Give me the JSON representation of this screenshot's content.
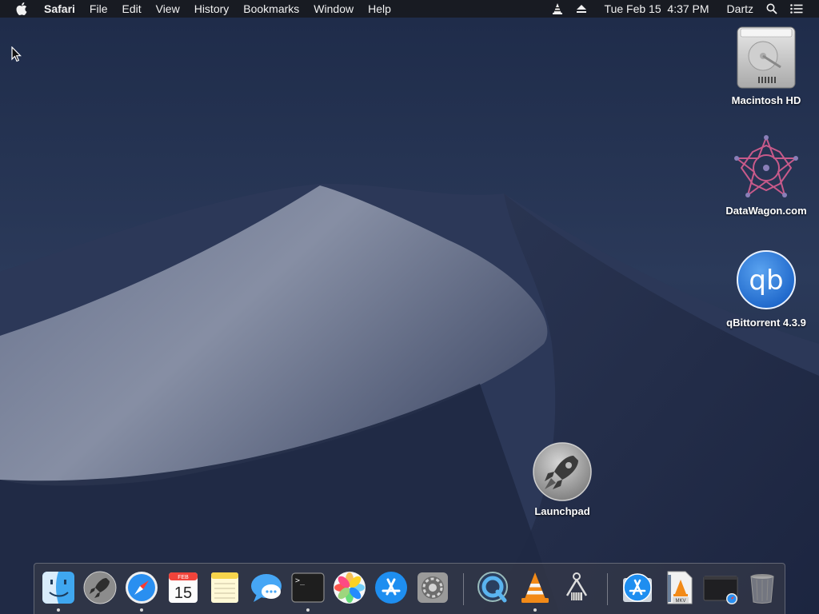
{
  "menubar": {
    "apple_icon": "apple-logo-icon",
    "app_name": "Safari",
    "menus": [
      "File",
      "Edit",
      "View",
      "History",
      "Bookmarks",
      "Window",
      "Help"
    ],
    "status": {
      "vlc_icon": "vlc-cone-icon",
      "eject_icon": "eject-icon",
      "datetime": "Tue Feb 15  4:37 PM",
      "user": "Dartz",
      "spotlight_icon": "search-icon",
      "notification_icon": "notification-center-icon"
    }
  },
  "desktop": {
    "icons": [
      {
        "label": "Macintosh HD",
        "icon": "hard-drive-icon"
      },
      {
        "label": "DataWagon.com",
        "icon": "datawagon-star-icon"
      },
      {
        "label": "qBittorrent 4.3.9",
        "icon": "qbittorrent-icon",
        "glyph": "qb"
      },
      {
        "label": "Launchpad",
        "icon": "launchpad-rocket-icon"
      }
    ]
  },
  "dock": {
    "items": [
      {
        "name": "Finder",
        "icon": "finder-icon",
        "running": true
      },
      {
        "name": "Launchpad",
        "icon": "launchpad-icon",
        "running": false
      },
      {
        "name": "Safari",
        "icon": "safari-icon",
        "running": true
      },
      {
        "name": "Calendar",
        "icon": "calendar-icon",
        "month": "FEB",
        "day": "15",
        "running": false
      },
      {
        "name": "Notes",
        "icon": "notes-icon",
        "running": false
      },
      {
        "name": "Messages",
        "icon": "messages-icon",
        "running": false
      },
      {
        "name": "Terminal",
        "icon": "terminal-icon",
        "glyph": ">_",
        "running": true
      },
      {
        "name": "Photos",
        "icon": "photos-icon",
        "running": false
      },
      {
        "name": "App Store",
        "icon": "app-store-icon",
        "running": false
      },
      {
        "name": "System Preferences",
        "icon": "system-preferences-icon",
        "running": false
      },
      {
        "name": "QuickTime Player",
        "icon": "quicktime-icon",
        "running": false
      },
      {
        "name": "VLC",
        "icon": "vlc-icon",
        "running": true
      },
      {
        "name": "Automator",
        "icon": "automator-icon",
        "running": false
      },
      {
        "name": "App Store Folder",
        "icon": "app-store-folder-icon",
        "running": false
      },
      {
        "name": "MKV File",
        "icon": "mkv-file-icon",
        "badge": "MKV",
        "running": false
      },
      {
        "name": "Safari Window",
        "icon": "safari-window-icon",
        "running": false
      },
      {
        "name": "Trash",
        "icon": "trash-icon",
        "running": false
      }
    ]
  }
}
